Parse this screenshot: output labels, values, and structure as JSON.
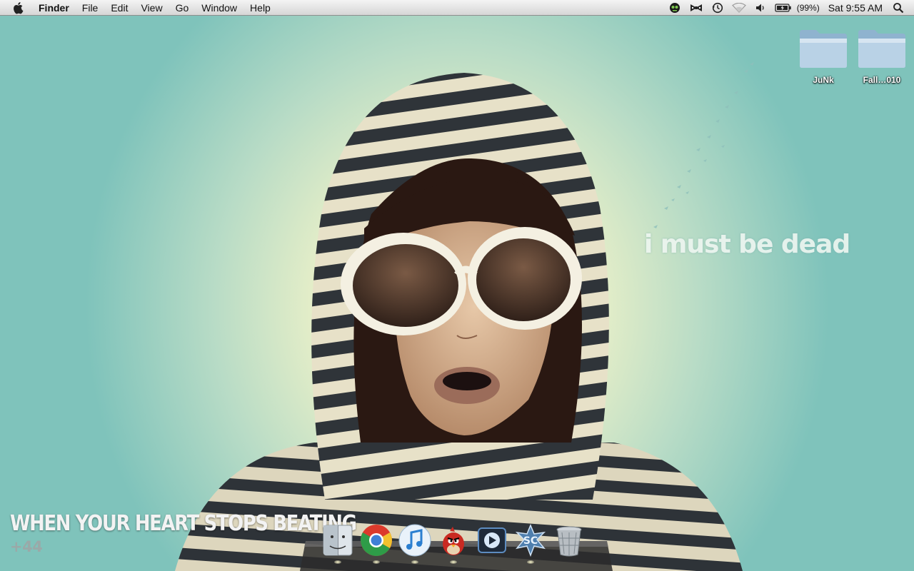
{
  "menubar": {
    "app_name": "Finder",
    "menus": [
      "File",
      "Edit",
      "View",
      "Go",
      "Window",
      "Help"
    ],
    "tray_icons": [
      "alien-app-icon",
      "bowtie-icon",
      "time-machine-icon",
      "wifi-icon",
      "volume-icon",
      "battery-icon"
    ],
    "battery_percent": "(99%)",
    "clock": "Sat 9:55 AM"
  },
  "desktop": {
    "icons": [
      {
        "label": "JuNk"
      },
      {
        "label": "Fall…010"
      }
    ],
    "wallpaper_slogan": "i must be dead",
    "wallpaper_caption": "WHEN YOUR HEART STOPS BEATING",
    "wallpaper_caption_sub": "+44"
  },
  "dock": {
    "items": [
      "finder",
      "chrome",
      "itunes",
      "angry-bird",
      "quicktime",
      "starcraft",
      "trash"
    ]
  },
  "colors": {
    "menubar_top": "#f4f4f4",
    "menubar_bottom": "#d6d6d6",
    "wallpaper_teal": "#7fc3bb",
    "wallpaper_center": "#f6f6cf",
    "hood_stripe": "#2f3439"
  }
}
